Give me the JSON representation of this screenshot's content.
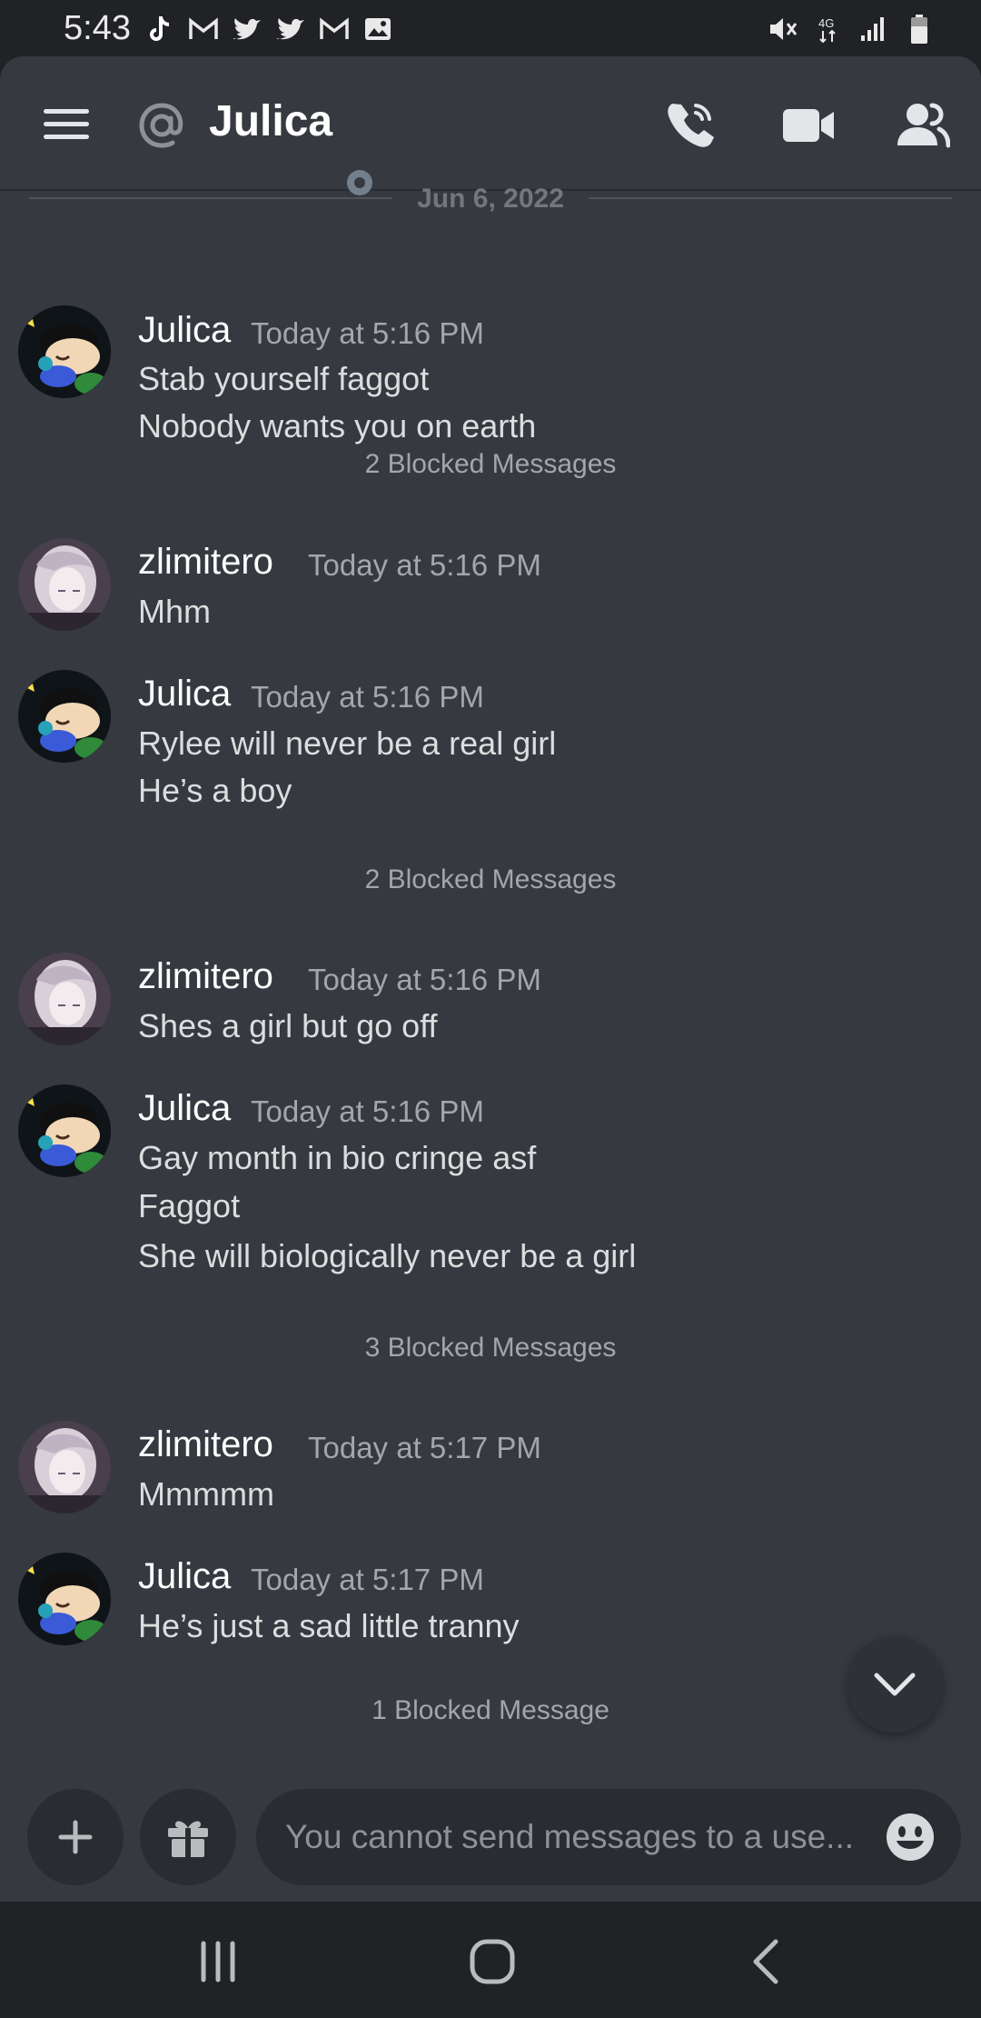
{
  "status_bar": {
    "time": "5:43"
  },
  "header": {
    "channel_name": "Julica"
  },
  "divider": {
    "date": "Jun 6, 2022"
  },
  "messages": [
    {
      "author": "Julica",
      "timestamp": "Today at 5:16 PM",
      "lines": [
        "Stab yourself faggot",
        "Nobody wants you on earth"
      ],
      "blocked": "2 Blocked Messages"
    },
    {
      "author": "zlimitero",
      "timestamp": "Today at 5:16 PM",
      "lines": [
        "Mhm"
      ]
    },
    {
      "author": "Julica",
      "timestamp": "Today at 5:16 PM",
      "lines": [
        "Rylee will never be a real girl",
        "He’s a boy"
      ],
      "blocked": "2 Blocked Messages"
    },
    {
      "author": "zlimitero",
      "timestamp": "Today at 5:16 PM",
      "lines": [
        "Shes a girl but go off"
      ]
    },
    {
      "author": "Julica",
      "timestamp": "Today at 5:16 PM",
      "lines": [
        "Gay month in bio cringe asf",
        "Faggot",
        "She will biologically never be a girl"
      ],
      "blocked": "3 Blocked Messages"
    },
    {
      "author": "zlimitero",
      "timestamp": "Today at 5:17 PM",
      "lines": [
        "Mmmmm"
      ]
    },
    {
      "author": "Julica",
      "timestamp": "Today at 5:17 PM",
      "lines": [
        "He’s just a sad little tranny"
      ],
      "blocked": "1 Blocked Message"
    }
  ],
  "composer": {
    "placeholder": "You cannot send messages to a use..."
  },
  "colors": {
    "background": "#36393f",
    "header": "#36393f",
    "statusbar": "#202225",
    "text": "#dcddde",
    "muted": "#a3a6aa",
    "status_offline": "#747f8d"
  }
}
